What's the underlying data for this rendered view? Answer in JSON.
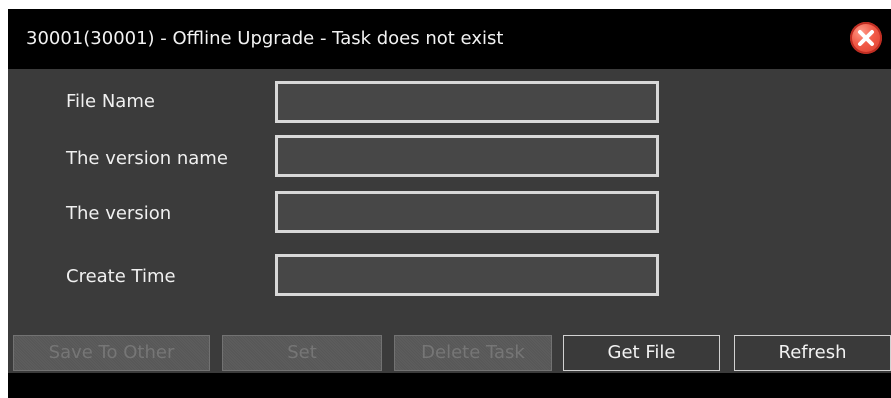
{
  "window": {
    "title": "30001(30001) - Offline Upgrade - Task does not exist",
    "close_icon": "close-icon",
    "colors": {
      "titlebar_background": "#000000",
      "window_background": "#3b3b3b",
      "close_button": "#f25b48",
      "input_border": "#d8d8d8",
      "disabled_button_text": "#767676",
      "enabled_button_border": "#d2d2d2"
    }
  },
  "form": {
    "file_name_label": "File Name",
    "file_name_value": "",
    "version_name_label": "The version name",
    "version_name_value": "",
    "version_label": "The version",
    "version_value": "",
    "create_time_label": "Create Time",
    "create_time_value": ""
  },
  "buttons": {
    "save_to_other": "Save To Other",
    "set": "Set",
    "delete_task": "Delete Task",
    "get_file": "Get File",
    "refresh": "Refresh"
  }
}
